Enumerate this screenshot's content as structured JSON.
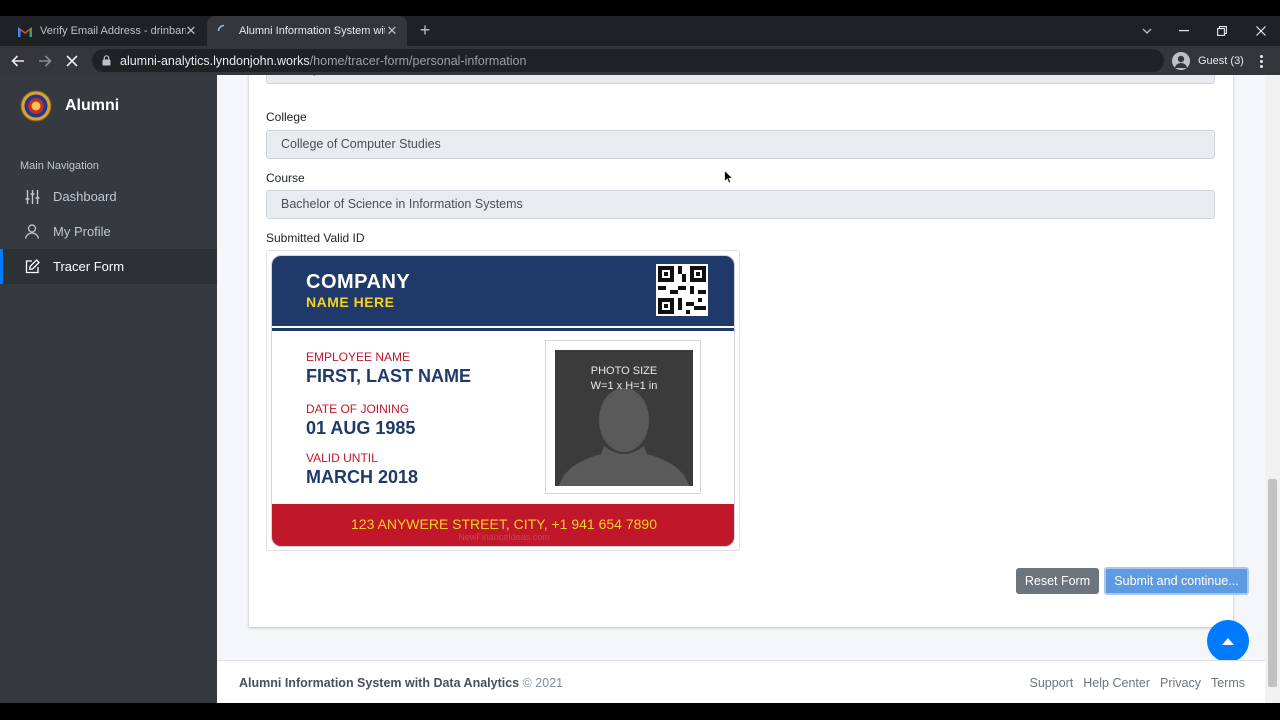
{
  "browser": {
    "tabs": [
      {
        "title": "Verify Email Address - drinbarne",
        "favicon": "gmail-icon",
        "active": false
      },
      {
        "title": "Alumni Information System with D",
        "favicon": "loading-icon",
        "active": true
      }
    ],
    "url_host": "alumni-analytics.lyndonjohn.works",
    "url_path": "/home/tracer-form/personal-information",
    "profile_label": "Guest (3)"
  },
  "sidebar": {
    "brand": "Alumni",
    "nav_header": "Main Navigation",
    "items": [
      {
        "label": "Dashboard",
        "icon": "sliders-icon",
        "active": false
      },
      {
        "label": "My Profile",
        "icon": "user-icon",
        "active": false
      },
      {
        "label": "Tracer Form",
        "icon": "edit-icon",
        "active": true
      }
    ]
  },
  "form": {
    "partial_value": "Talisay",
    "college_label": "College",
    "college_value": "College of Computer Studies",
    "course_label": "Course",
    "course_value": "Bachelor of Science in Information Systems",
    "valid_id_label": "Submitted Valid ID"
  },
  "id_card": {
    "company": "COMPANY",
    "company_sub": "NAME HERE",
    "employee_label": "EMPLOYEE NAME",
    "employee_value": "FIRST, LAST NAME",
    "doj_label": "DATE OF JOINING",
    "doj_value": "01 AUG 1985",
    "valid_label": "VALID UNTIL",
    "valid_value": "MARCH 2018",
    "photo_line1": "PHOTO SIZE",
    "photo_line2": "W=1 x H=1 in",
    "address": "123 ANYWERE STREET, CITY, +1 941 654 7890",
    "watermark": "NewFinanceIdeas.com",
    "colors": {
      "navy": "#1f3a6a",
      "red": "#c0172b",
      "yellow": "#f7d21f"
    }
  },
  "buttons": {
    "reset": "Reset Form",
    "submit": "Submit and continue..."
  },
  "footer": {
    "app_name": "Alumni Information System with Data Analytics",
    "copyright": "© 2021",
    "links": [
      "Support",
      "Help Center",
      "Privacy",
      "Terms"
    ]
  },
  "theme": {
    "sidebar_bg": "#343a40",
    "primary": "#007bff",
    "content_bg": "#f4f6f9"
  }
}
